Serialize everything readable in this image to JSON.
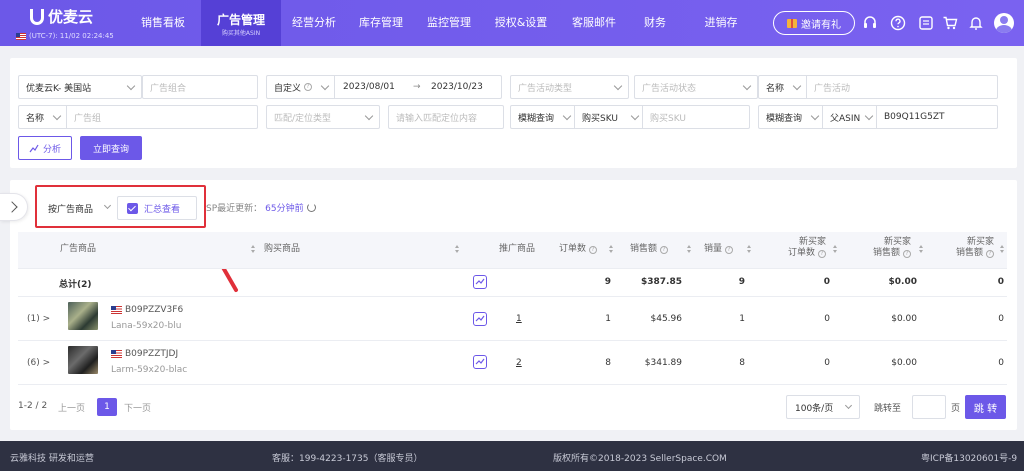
{
  "nav": {
    "brand": "优麦云",
    "timezone": "(UTC-7): 11/02 02:24:45",
    "items": [
      {
        "label": "销售看板"
      },
      {
        "label": "广告管理",
        "sub": "购买其他ASIN"
      },
      {
        "label": "经营分析"
      },
      {
        "label": "库存管理"
      },
      {
        "label": "监控管理"
      },
      {
        "label": "授权&设置"
      },
      {
        "label": "客服邮件"
      },
      {
        "label": "财务"
      },
      {
        "label": "进销存"
      }
    ],
    "invite": "邀请有礼"
  },
  "filters": {
    "shop": "优麦云K- 美国站",
    "ad_portfolio_ph": "广告组合",
    "date_mode": "自定义",
    "date_start": "2023/08/01",
    "date_sep": "→",
    "date_end": "2023/10/23",
    "campaign_type_ph": "广告活动类型",
    "campaign_status_ph": "广告活动状态",
    "campaign_field": "名称",
    "campaign_ph": "广告活动",
    "group_field": "名称",
    "group_ph": "广告组",
    "match_type_ph": "匹配/定位类型",
    "match_content_ph": "请输入匹配定位内容",
    "fuzzy1": "模糊查询",
    "buy_sku_label": "购买SKU",
    "buy_sku_ph": "购买SKU",
    "fuzzy2": "模糊查询",
    "parent_asin_label": "父ASIN",
    "parent_asin_value": "B09Q11G5ZT",
    "analyze_btn": "分析",
    "query_btn": "立即查询"
  },
  "toolbar": {
    "group_by": "按广告商品",
    "summary": "汇总查看",
    "update_prefix": "SP最近更新：",
    "update_value": "65分钟前"
  },
  "table": {
    "headers": {
      "ad_product": "广告商品",
      "buy_product": "购买商品",
      "promoted": "推广商品",
      "orders": "订单数",
      "sales": "销售额",
      "units": "销量",
      "new_orders_1": "新买家",
      "new_orders_2": "订单数",
      "new_sales_1": "新买家",
      "new_sales_2": "销售额",
      "new_sales_pct_1": "新买家",
      "new_sales_pct_2": "销售额"
    },
    "total": {
      "label": "总计(2)",
      "orders": "9",
      "sales": "$387.85",
      "units": "9",
      "new_orders": "0",
      "new_sales": "$0.00",
      "new_pct": "0"
    },
    "rows": [
      {
        "expand": "(1)",
        "asin": "B09PZZV3F6",
        "name": "Lana-59x20-blu",
        "promoted": "1",
        "orders": "1",
        "sales": "$45.96",
        "units": "1",
        "new_orders": "0",
        "new_sales": "$0.00",
        "new_pct": "0"
      },
      {
        "expand": "(6)",
        "asin": "B09PZZTJDJ",
        "name": "Larm-59x20-blac",
        "promoted": "2",
        "orders": "8",
        "sales": "$341.89",
        "units": "8",
        "new_orders": "0",
        "new_sales": "$0.00",
        "new_pct": "0"
      }
    ]
  },
  "pagination": {
    "range": "1-2 / 2",
    "prev": "上一页",
    "page": "1",
    "next": "下一页",
    "per_page": "100条/页",
    "jump_label": "跳转至",
    "page_unit": "页",
    "go": "跳 转"
  },
  "footer": {
    "left": "云雅科技 研发和运营",
    "service": "客服：199-4223-1735（客服专员）",
    "copyright": "版权所有©2018-2023 SellerSpace.COM",
    "icp": "粤ICP备13020601号-9"
  }
}
